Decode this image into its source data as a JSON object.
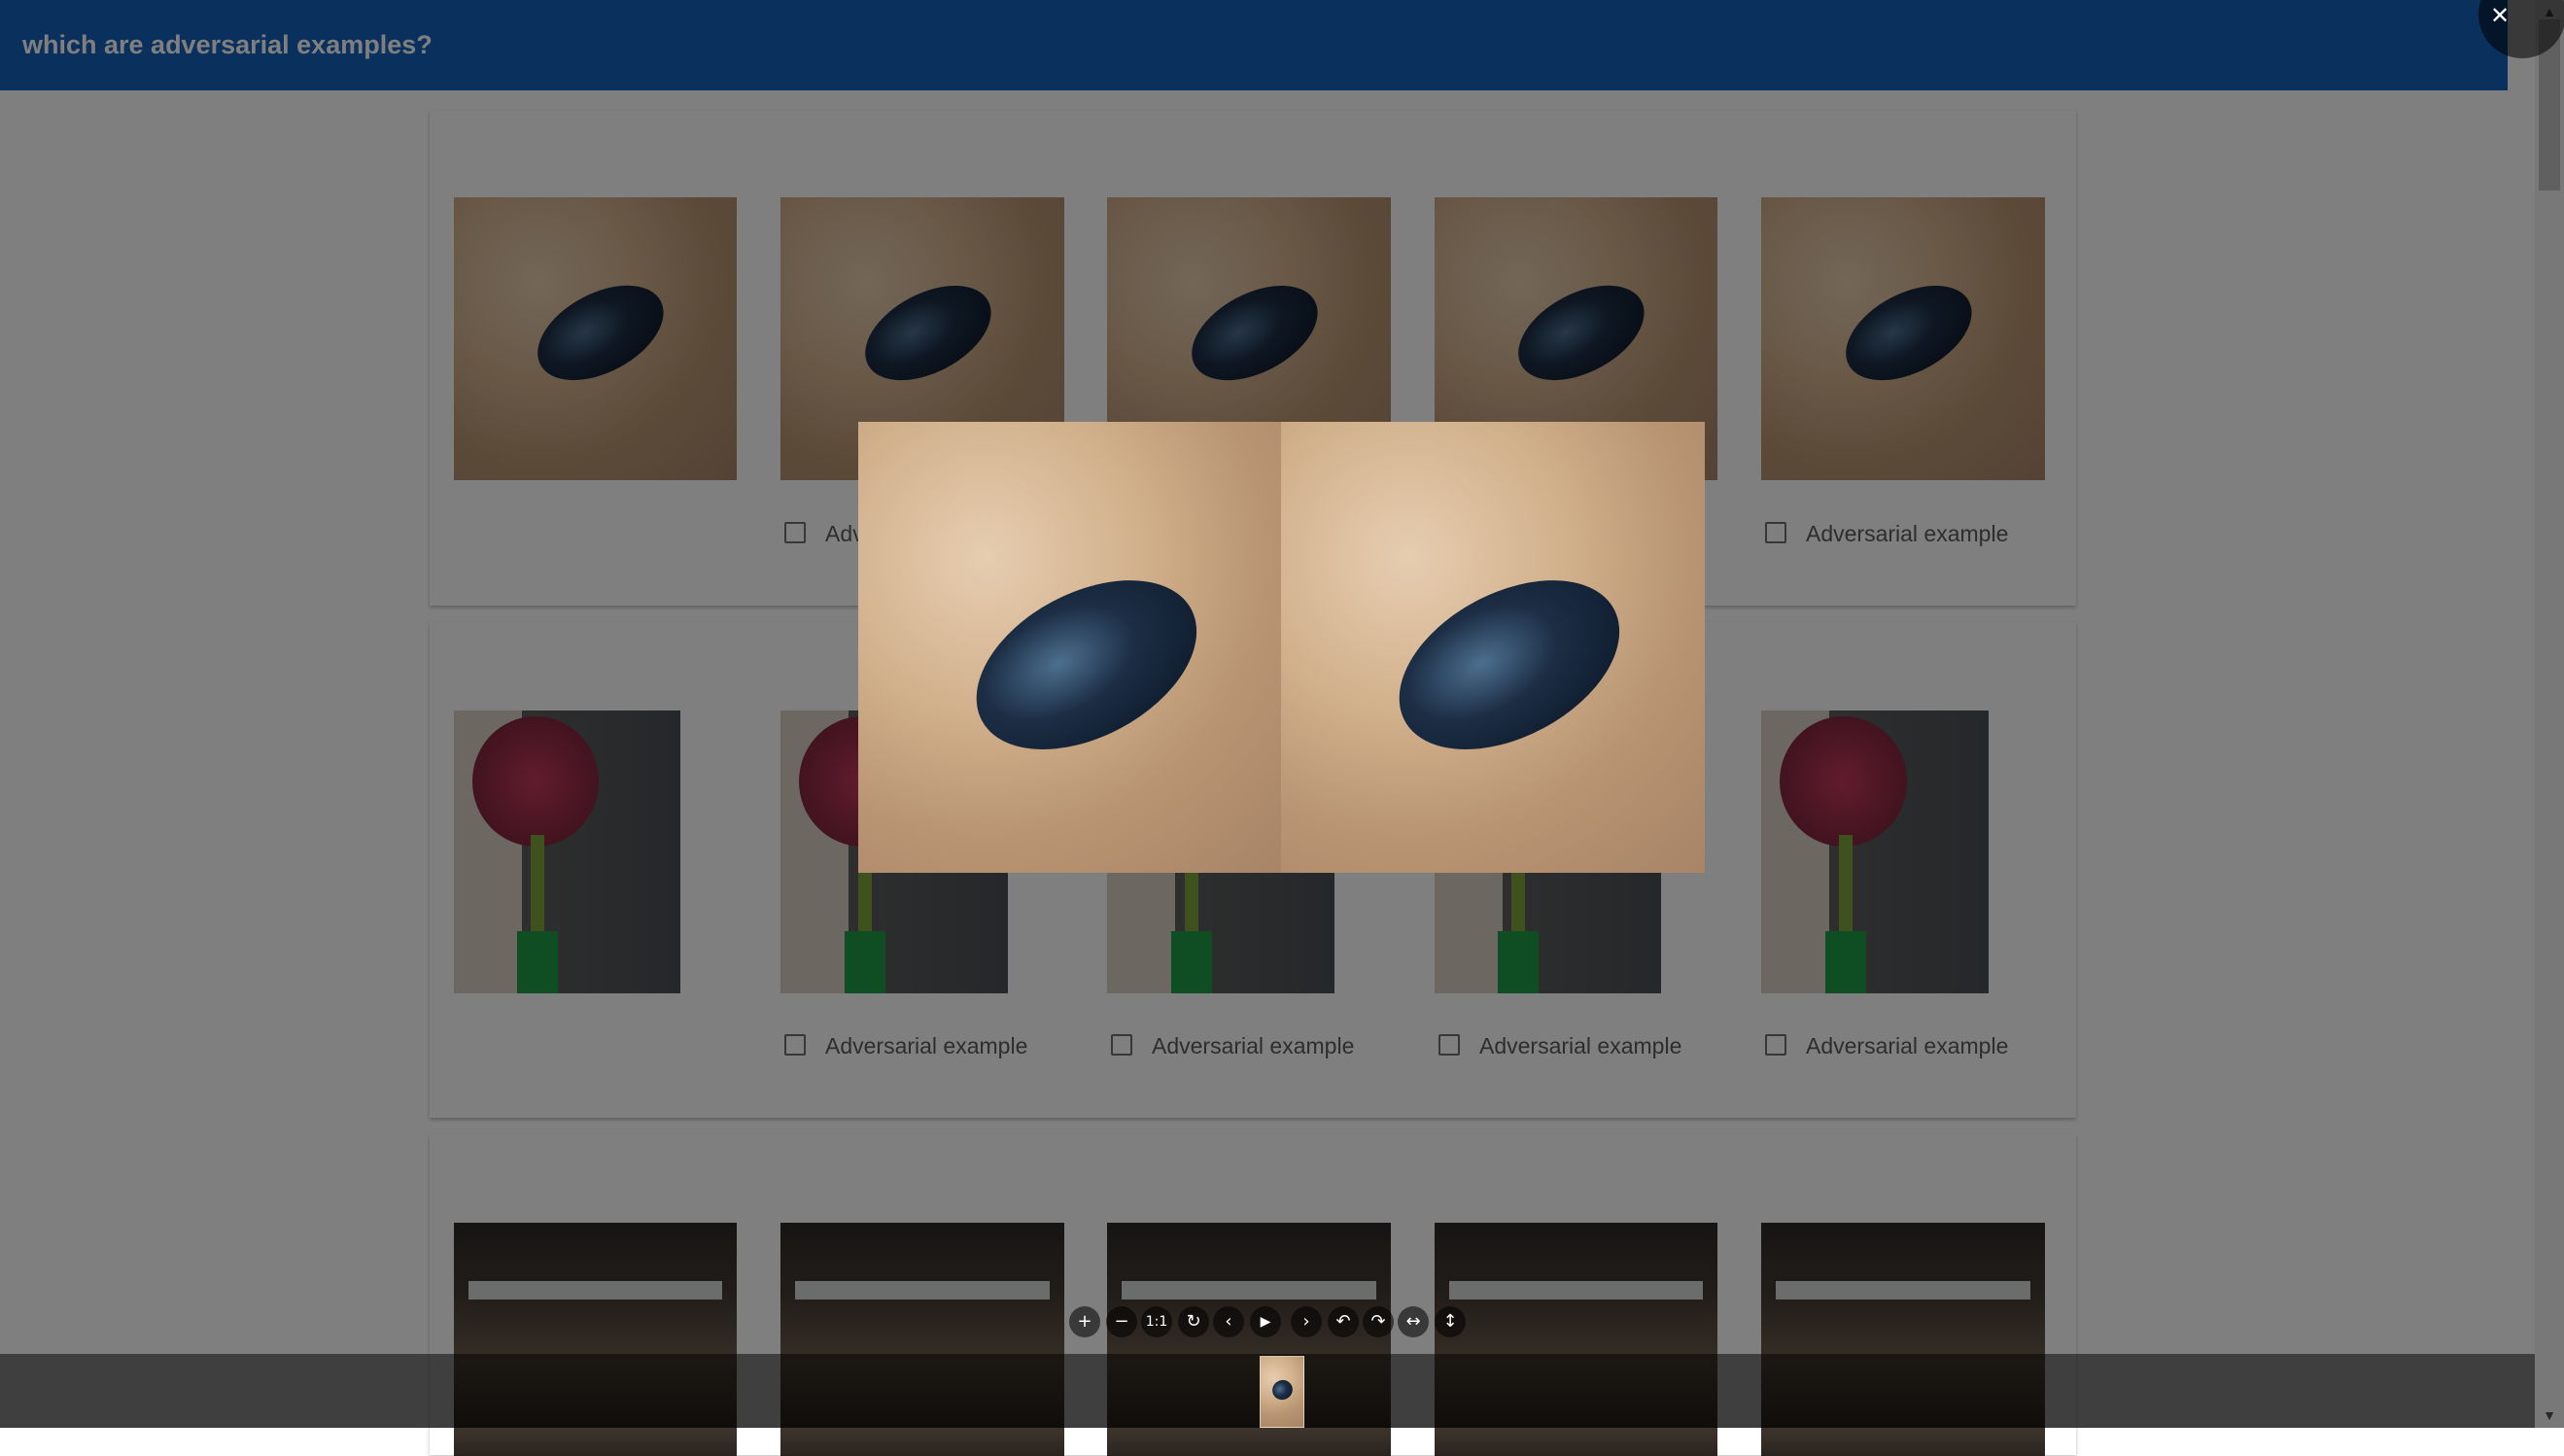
{
  "app": {
    "title": "which are adversarial examples?"
  },
  "colors": {
    "header": "#1560bd",
    "overlay": "rgba(0,0,0,0.5)"
  },
  "groups": [
    {
      "subject": "beetle",
      "checkbox_labels": [
        "Adversarial example",
        "Adversarial example"
      ]
    },
    {
      "subject": "flower",
      "checkbox_labels": [
        "Adversarial example",
        "Adversarial example",
        "Adversarial example",
        "Adversarial example"
      ]
    },
    {
      "subject": "cafe",
      "checkbox_labels": []
    }
  ],
  "viewer": {
    "toolbar_icons": [
      "zoom-in-icon",
      "zoom-out-icon",
      "one-to-one-icon",
      "reset-icon",
      "prev-icon",
      "play-icon",
      "next-icon",
      "rotate-left-icon",
      "rotate-right-icon",
      "flip-horizontal-icon",
      "flip-vertical-icon"
    ],
    "one_to_one_label": "1:1",
    "close_icon": "close-icon"
  }
}
